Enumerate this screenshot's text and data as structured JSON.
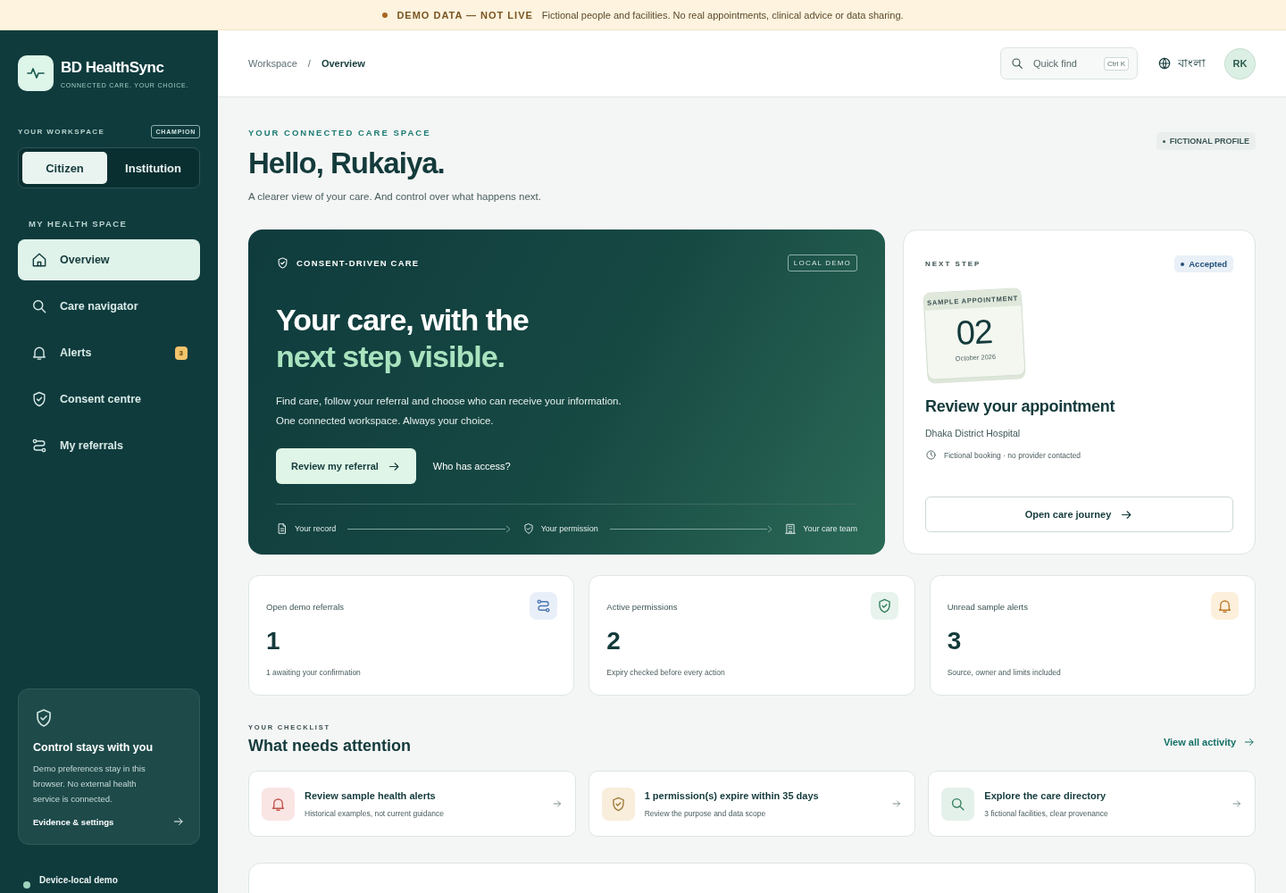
{
  "banner": {
    "label": "DEMO DATA — NOT LIVE",
    "text": "Fictional people and facilities. No real appointments, clinical advice or data sharing."
  },
  "brand": {
    "name": "BD HealthSync",
    "tagline": "CONNECTED CARE. YOUR CHOICE."
  },
  "workspace": {
    "label": "YOUR WORKSPACE",
    "badge": "CHAMPION",
    "modes": [
      {
        "label": "Citizen",
        "selected": true
      },
      {
        "label": "Institution",
        "selected": false
      }
    ]
  },
  "nav": {
    "heading": "MY HEALTH SPACE",
    "items": [
      {
        "label": "Overview",
        "kind": "home",
        "selected": true
      },
      {
        "label": "Care navigator",
        "kind": "search",
        "selected": false
      },
      {
        "label": "Alerts",
        "kind": "bell",
        "selected": false,
        "badge": "3"
      },
      {
        "label": "Consent centre",
        "kind": "shield",
        "selected": false
      },
      {
        "label": "My referrals",
        "kind": "route",
        "selected": false
      }
    ]
  },
  "control_card": {
    "title": "Control stays with you",
    "text": "Demo preferences stay in this browser. No external health service is connected.",
    "link": "Evidence & settings"
  },
  "device_status": {
    "label": "Device-local demo"
  },
  "breadcrumb_separator": "/",
  "breadcrumb": [
    {
      "label": "Workspace",
      "current": false
    },
    {
      "label": "Overview",
      "current": true
    }
  ],
  "search": {
    "placeholder": "Quick find",
    "shortcut": "Ctrl K"
  },
  "language": "বাংলা",
  "avatar": "RK",
  "greeting": {
    "eyebrow": "YOUR CONNECTED CARE SPACE",
    "title": "Hello, Rukaiya.",
    "subtitle": "A clearer view of your care. And control over what happens next.",
    "badge": "FICTIONAL PROFILE"
  },
  "hero": {
    "tag": "CONSENT-DRIVEN CARE",
    "badge": "LOCAL DEMO",
    "title": [
      "Your care, with the",
      "next step visible."
    ],
    "lines": [
      "Find care, follow your referral and choose who can receive your information.",
      "One connected workspace. Always your choice."
    ],
    "primary_button": "Review my referral",
    "secondary_link": "Who has access?",
    "flow": [
      {
        "label": "Your record",
        "kind": "file"
      },
      {
        "label": "Your permission",
        "kind": "shield"
      },
      {
        "label": "Your care team",
        "kind": "building"
      }
    ]
  },
  "next_step": {
    "label": "NEXT STEP",
    "status": "Accepted",
    "calendar": {
      "label": "SAMPLE APPOINTMENT",
      "day": "02",
      "month": "October 2026"
    },
    "title": "Review your appointment",
    "place": "Dhaka District Hospital",
    "note": "Fictional booking · no provider contacted",
    "button": "Open care journey"
  },
  "stats": [
    {
      "label": "Open demo referrals",
      "value": "1",
      "note": "1 awaiting your confirmation",
      "kind": "route",
      "color": "#e9eff8"
    },
    {
      "label": "Active permissions",
      "value": "2",
      "note": "Expiry checked before every action",
      "kind": "shield",
      "color": "#e7f3ec"
    },
    {
      "label": "Unread sample alerts",
      "value": "3",
      "note": "Source, owner and limits included",
      "kind": "bell",
      "color": "#fcefdc"
    }
  ],
  "checklist": {
    "eyebrow": "YOUR CHECKLIST",
    "title": "What needs attention",
    "link": "View all activity",
    "items": [
      {
        "title": "Review sample health alerts",
        "text": "Historical examples, not current guidance",
        "kind": "bell",
        "color": "#f9e5e3"
      },
      {
        "title": "1 permission(s) expire within 35 days",
        "text": "Review the purpose and data scope",
        "kind": "shield",
        "color": "#f9eddb"
      },
      {
        "title": "Explore the care directory",
        "text": "3 fictional facilities, clear provenance",
        "kind": "search",
        "color": "#e4f1ea"
      }
    ]
  }
}
